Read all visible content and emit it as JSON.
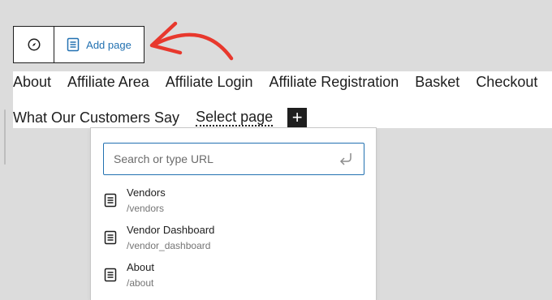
{
  "toolbar": {
    "compass_icon": "compass-icon",
    "add_page_icon": "page-icon",
    "add_page_label": "Add page",
    "accent_color": "#2271b1"
  },
  "annotation": {
    "arrow_color": "#e8382d"
  },
  "nav": {
    "row1": [
      "About",
      "Affiliate Area",
      "Affiliate Login",
      "Affiliate Registration",
      "Basket",
      "Checkout"
    ],
    "row2": [
      "What Our Customers Say"
    ],
    "select_page_label": "Select page",
    "add_icon": "plus-icon"
  },
  "search": {
    "placeholder": "Search or type URL",
    "value": "",
    "submit_icon": "enter-icon"
  },
  "results": [
    {
      "title": "Vendors",
      "path": "/vendors"
    },
    {
      "title": "Vendor Dashboard",
      "path": "/vendor_dashboard"
    },
    {
      "title": "About",
      "path": "/about"
    }
  ]
}
